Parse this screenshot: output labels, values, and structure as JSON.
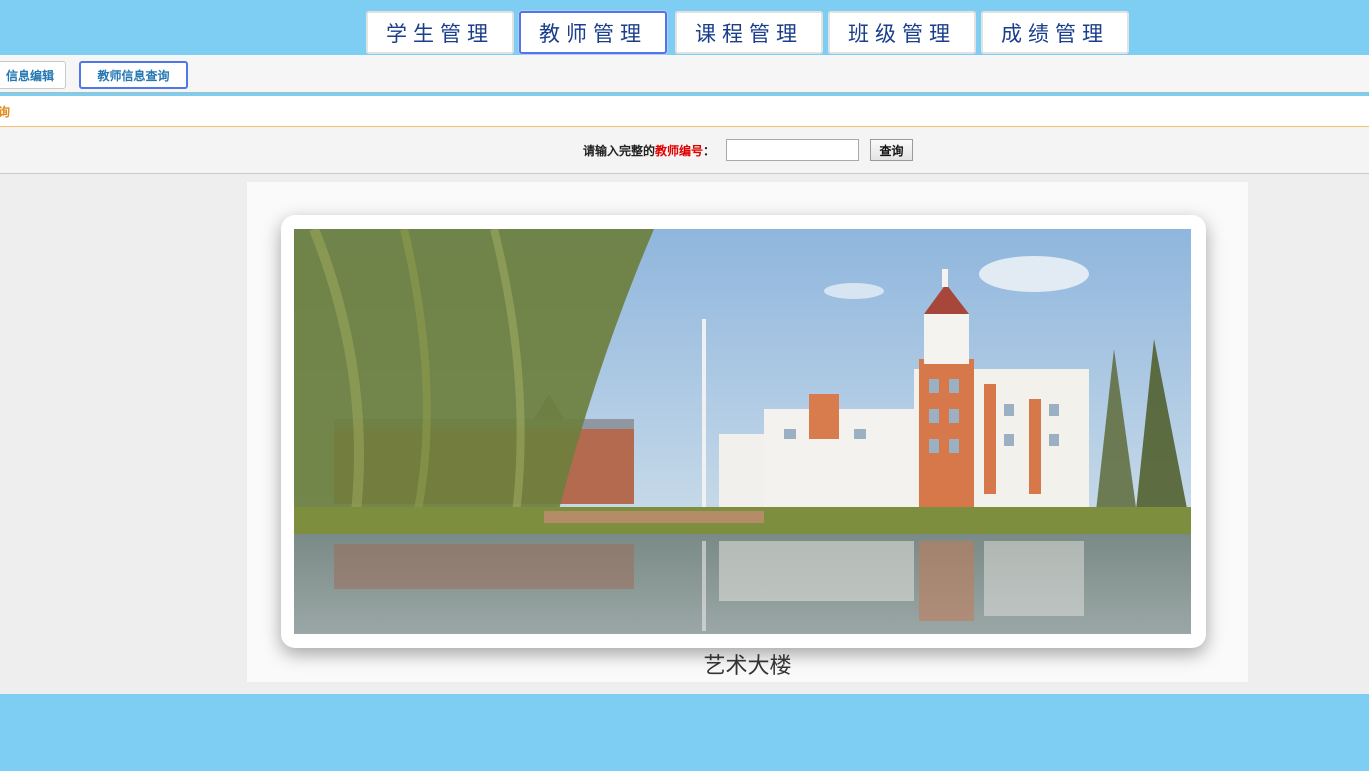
{
  "top_nav": {
    "items": [
      {
        "label": "学生管理"
      },
      {
        "label": "教师管理"
      },
      {
        "label": "课程管理"
      },
      {
        "label": "班级管理"
      },
      {
        "label": "成绩管理"
      }
    ],
    "active_index": 1
  },
  "sub_tabs": {
    "edit_label": "信息编辑",
    "query_label": "教师信息查询"
  },
  "breadcrumb": "询",
  "query": {
    "label_prefix": "请输入完整的",
    "label_highlight": "教师编号",
    "label_suffix": "：",
    "input_value": "",
    "button_label": "查询"
  },
  "photo": {
    "caption": "艺术大楼",
    "icon": "campus-building-photo"
  },
  "colors": {
    "page_blue": "#7ecef4",
    "nav_text": "#1a3e8c",
    "active_border": "#4f77e8",
    "crumb_orange": "#e38a1c",
    "highlight_red": "#e00000"
  }
}
